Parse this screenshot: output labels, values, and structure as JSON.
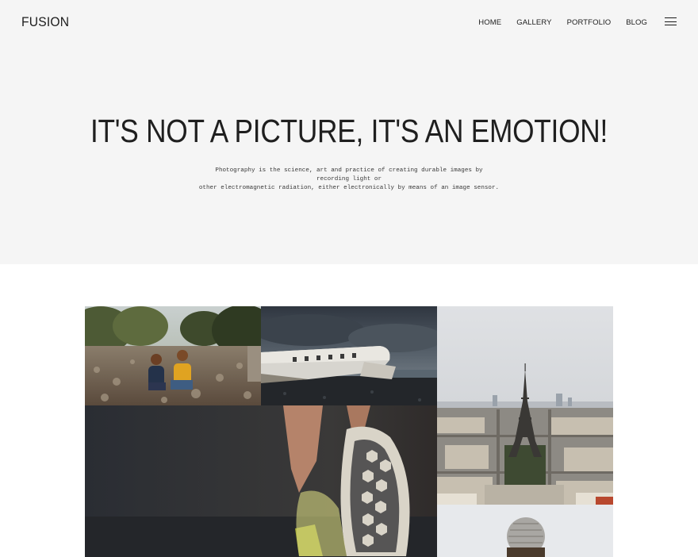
{
  "header": {
    "logo": "FUSION",
    "nav": [
      "HOME",
      "GALLERY",
      "PORTFOLIO",
      "BLOG"
    ],
    "menu_icon": "hamburger-icon"
  },
  "hero": {
    "headline": "IT'S NOT A PICTURE, IT'S AN EMOTION!",
    "subtitle_line1": "Photography is the science, art and practice of creating durable images by recording light or",
    "subtitle_line2": "other electromagnetic radiation, either electronically by means of an image sensor."
  },
  "gallery": {
    "tiles": [
      "children-photo",
      "plane-wreck-photo",
      "eiffel-tower-photo",
      "sneaker-photo",
      "knit-hat-photo"
    ]
  },
  "colors": {
    "hero_bg": "#f5f5f5",
    "text": "#1c1c1c",
    "page_bg": "#ffffff"
  }
}
